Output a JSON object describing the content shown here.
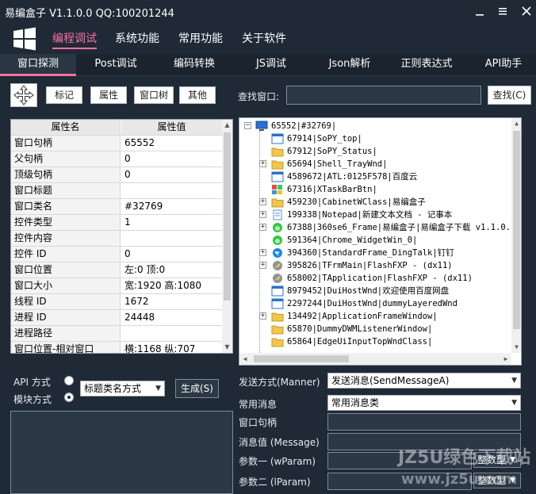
{
  "window": {
    "title": "易编盒子 V1.1.0.0 QQ:100201244",
    "controls": [
      "minimize-icon",
      "menu-icon",
      "close-icon"
    ]
  },
  "top_menu": [
    {
      "label": "编程调试",
      "active": true
    },
    {
      "label": "系统功能",
      "active": false
    },
    {
      "label": "常用功能",
      "active": false
    },
    {
      "label": "关于软件",
      "active": false
    }
  ],
  "sub_tabs": [
    {
      "label": "窗口探测",
      "active": true
    },
    {
      "label": "Post调试"
    },
    {
      "label": "编码转换"
    },
    {
      "label": "JS调试"
    },
    {
      "label": "Json解析"
    },
    {
      "label": "正则表达式"
    },
    {
      "label": "API助手"
    }
  ],
  "toolbar": {
    "crosshair_icon": "crosshair-move-icon",
    "buttons": [
      "标记",
      "属性",
      "窗口树",
      "其他"
    ],
    "find_label": "查找窗口:",
    "find_value": "",
    "find_button": "查找(C)"
  },
  "props": {
    "header": {
      "key": "属性名",
      "value": "属性值"
    },
    "rows": [
      {
        "key": "窗口句柄",
        "value": "65552"
      },
      {
        "key": "父句柄",
        "value": "0"
      },
      {
        "key": "顶级句柄",
        "value": "0"
      },
      {
        "key": "窗口标题",
        "value": ""
      },
      {
        "key": "窗口类名",
        "value": "#32769"
      },
      {
        "key": "控件类型",
        "value": "1"
      },
      {
        "key": "控件内容",
        "value": ""
      },
      {
        "key": "控件 ID",
        "value": "0"
      },
      {
        "key": "窗口位置",
        "value": "左:0 顶:0"
      },
      {
        "key": "窗口大小",
        "value": "宽:1920 高:1080"
      },
      {
        "key": "线程 ID",
        "value": "1672"
      },
      {
        "key": "进程 ID",
        "value": "24448"
      },
      {
        "key": "进程路径",
        "value": ""
      },
      {
        "key": "窗口位置-相对窗口",
        "value": "横:1168 纵:707"
      }
    ]
  },
  "tree": {
    "root": "65552|#32769|",
    "items": [
      {
        "text": "67914|SoPY_top|",
        "expandable": false,
        "icon": "window"
      },
      {
        "text": "67912|SoPY_Status|",
        "expandable": false,
        "icon": "folder"
      },
      {
        "text": "65694|Shell_TrayWnd|",
        "expandable": true,
        "icon": "folder"
      },
      {
        "text": "4589672|ATL:0125F578|百度云",
        "expandable": false,
        "icon": "window"
      },
      {
        "text": "67316|XTaskBarBtn|",
        "expandable": false,
        "icon": "app"
      },
      {
        "text": "459230|CabinetWClass|易编盒子",
        "expandable": true,
        "icon": "folder"
      },
      {
        "text": "199338|Notepad|新建文本文档 - 记事本",
        "expandable": true,
        "icon": "notepad"
      },
      {
        "text": "67388|360se6_Frame|易编盒子|易编盒子下载 v1.1.0.",
        "expandable": true,
        "icon": "browser"
      },
      {
        "text": "591364|Chrome_WidgetWin_0|",
        "expandable": false,
        "icon": "browser"
      },
      {
        "text": "394360|StandardFrame_DingTalk|钉钉",
        "expandable": true,
        "icon": "dingtalk"
      },
      {
        "text": "395826|TFrmMain|FlashFXP - (dx11)",
        "expandable": true,
        "icon": "flashfxp"
      },
      {
        "text": "658002|TApplication|FlashFXP - (dx11)",
        "expandable": false,
        "icon": "flashfxp"
      },
      {
        "text": "8979452|DuiHostWnd|欢迎使用百度网盘",
        "expandable": false,
        "icon": "window"
      },
      {
        "text": "2297244|DuiHostWnd|dummyLayeredWnd",
        "expandable": false,
        "icon": "window"
      },
      {
        "text": "134492|ApplicationFrameWindow|",
        "expandable": true,
        "icon": "folder"
      },
      {
        "text": "65870|DummyDWMListenerWindow|",
        "expandable": false,
        "icon": "folder"
      },
      {
        "text": "65864|EdgeUiInputTopWndClass|",
        "expandable": false,
        "icon": "folder"
      }
    ]
  },
  "api_panel": {
    "api_label": "API 方式",
    "module_label": "模块方式",
    "api_selected": false,
    "module_selected": true,
    "method_select": "标题类名方式",
    "generate_button": "生成(S)"
  },
  "send_panel": {
    "send_mode_label": "发送方式(Manner)",
    "send_mode_value": "发送消息(SendMessageA)",
    "common_msg_label": "常用消息",
    "common_msg_value": "常用消息类",
    "hwnd_label": "窗口句柄",
    "msg_value_label": "消息值 (Message)",
    "param1_label": "参数一 (wParam)",
    "param2_label": "参数二 (lParam)",
    "param1_type": "整数型",
    "param2_type": "整数型"
  },
  "watermark": {
    "line1": "JZ5U绿色下载站",
    "line2": "www.jz5u.com"
  },
  "colors": {
    "bg": "#1f2a36",
    "accent": "#ff6fa1",
    "tab_bar": "#1a232e"
  }
}
